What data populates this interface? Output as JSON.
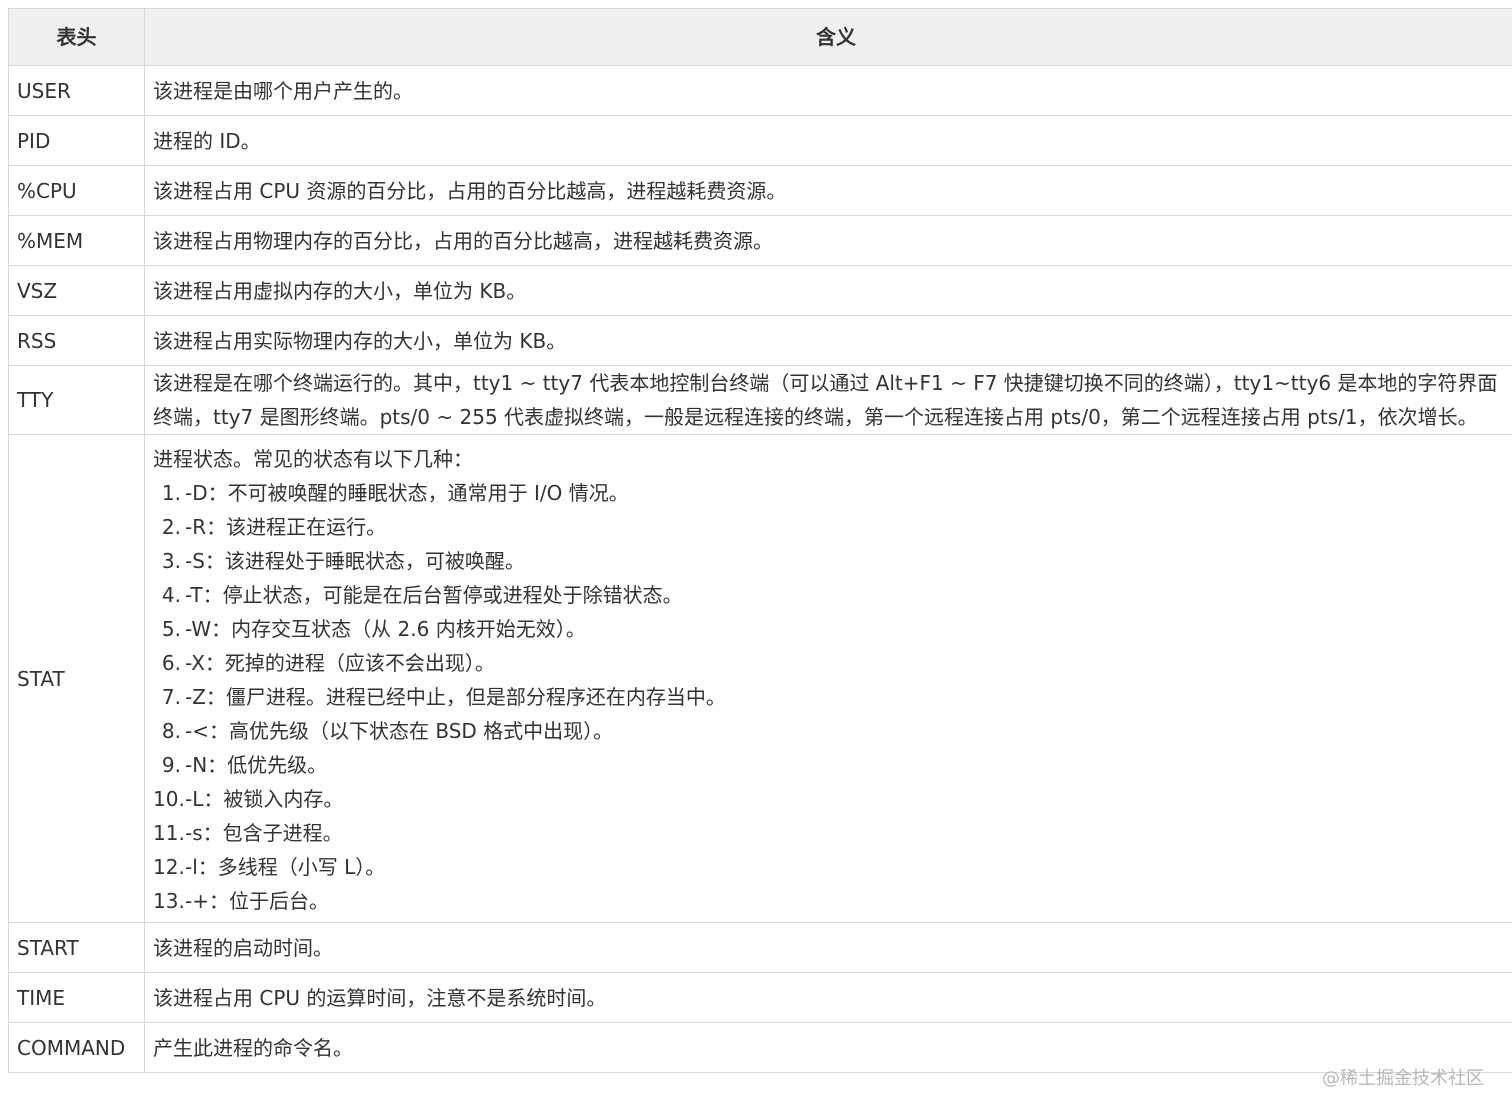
{
  "table": {
    "headers": [
      "表头",
      "含义"
    ],
    "rows": [
      {
        "name": "USER",
        "desc": "该进程是由哪个用户产生的。"
      },
      {
        "name": "PID",
        "desc": "进程的 ID。"
      },
      {
        "name": "%CPU",
        "desc": "该进程占用 CPU 资源的百分比，占用的百分比越高，进程越耗费资源。"
      },
      {
        "name": "%MEM",
        "desc": "该进程占用物理内存的百分比，占用的百分比越高，进程越耗费资源。"
      },
      {
        "name": "VSZ",
        "desc": "该进程占用虚拟内存的大小，单位为 KB。"
      },
      {
        "name": "RSS",
        "desc": "该进程占用实际物理内存的大小，单位为 KB。"
      },
      {
        "name": "TTY",
        "desc": "该进程是在哪个终端运行的。其中，tty1 ~ tty7 代表本地控制台终端（可以通过 Alt+F1 ~ F7 快捷键切换不同的终端），tty1~tty6 是本地的字符界面终端，tty7 是图形终端。pts/0 ~ 255 代表虚拟终端，一般是远程连接的终端，第一个远程连接占用 pts/0，第二个远程连接占用 pts/1，依次增长。"
      },
      {
        "name": "STAT",
        "intro": "进程状态。常见的状态有以下几种：",
        "items": [
          {
            "num": "1.",
            "text": "-D：不可被唤醒的睡眠状态，通常用于 I/O 情况。"
          },
          {
            "num": "2.",
            "text": "-R：该进程正在运行。"
          },
          {
            "num": "3.",
            "text": "-S：该进程处于睡眠状态，可被唤醒。"
          },
          {
            "num": "4.",
            "text": "-T：停止状态，可能是在后台暂停或进程处于除错状态。"
          },
          {
            "num": "5.",
            "text": "-W：内存交互状态（从 2.6 内核开始无效）。"
          },
          {
            "num": "6.",
            "text": "-X：死掉的进程（应该不会出现）。"
          },
          {
            "num": "7.",
            "text": "-Z：僵尸进程。进程已经中止，但是部分程序还在内存当中。"
          },
          {
            "num": "8.",
            "text": "-<：高优先级（以下状态在 BSD 格式中出现）。"
          },
          {
            "num": "9.",
            "text": "-N：低优先级。"
          },
          {
            "num": "10.",
            "text": "-L：被锁入内存。"
          },
          {
            "num": "11.",
            "text": "-s：包含子进程。"
          },
          {
            "num": "12.",
            "text": "-l：多线程（小写 L）。"
          },
          {
            "num": "13.",
            "text": "-+：位于后台。"
          }
        ]
      },
      {
        "name": "START",
        "desc": "该进程的启动时间。"
      },
      {
        "name": "TIME",
        "desc": "该进程占用 CPU 的运算时间，注意不是系统时间。"
      },
      {
        "name": "COMMAND",
        "desc": "产生此进程的命令名。"
      }
    ]
  },
  "watermark": "@稀土掘金技术社区"
}
